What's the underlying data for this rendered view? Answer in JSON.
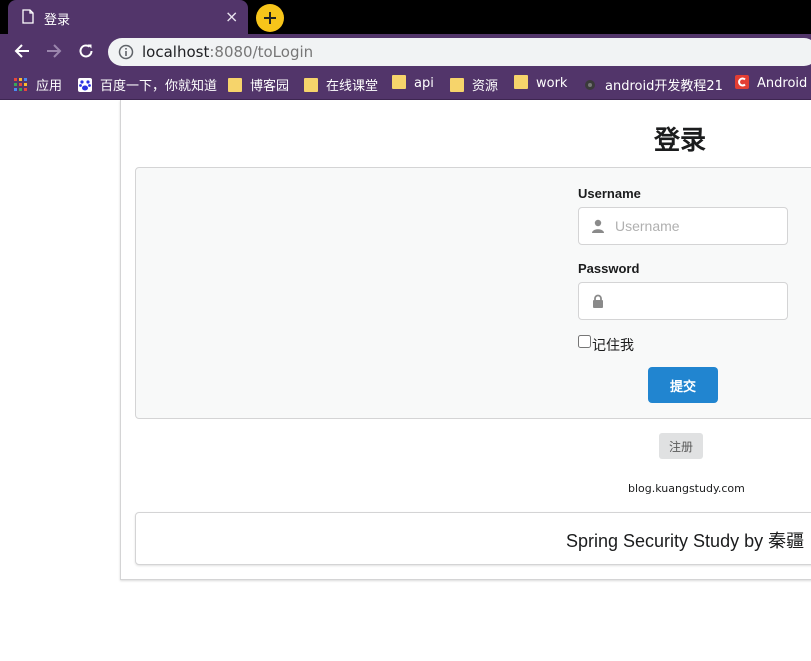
{
  "browser": {
    "tab": {
      "title": "登录",
      "close": "×"
    },
    "address": {
      "host": "localhost",
      "rest": ":8080/toLogin"
    },
    "bookmarks": [
      {
        "label": "应用",
        "icon": "apps-grid-icon"
      },
      {
        "label": "百度一下，你就知道",
        "icon": "baidu-paw-icon"
      },
      {
        "label": "博客园",
        "icon": "folder-icon"
      },
      {
        "label": "在线课堂",
        "icon": "folder-icon"
      },
      {
        "label": "api",
        "icon": "folder-icon"
      },
      {
        "label": "资源",
        "icon": "folder-icon"
      },
      {
        "label": "work",
        "icon": "folder-icon"
      },
      {
        "label": "android开发教程21",
        "icon": "site-favicon-icon"
      },
      {
        "label": "Android",
        "icon": "csdn-c-icon"
      }
    ]
  },
  "page": {
    "title": "登录",
    "form": {
      "username_label": "Username",
      "username_placeholder": "Username",
      "username_value": "",
      "password_label": "Password",
      "password_value": "",
      "remember_label": "记住我",
      "remember_checked": false,
      "submit_label": "提交"
    },
    "register_label": "注册",
    "blog_link": "blog.kuangstudy.com",
    "footer": "Spring Security Study by 秦疆"
  },
  "colors": {
    "chrome_purple": "#52356a",
    "accent_yellow": "#f7c51a",
    "primary_blue": "#2185d0"
  }
}
